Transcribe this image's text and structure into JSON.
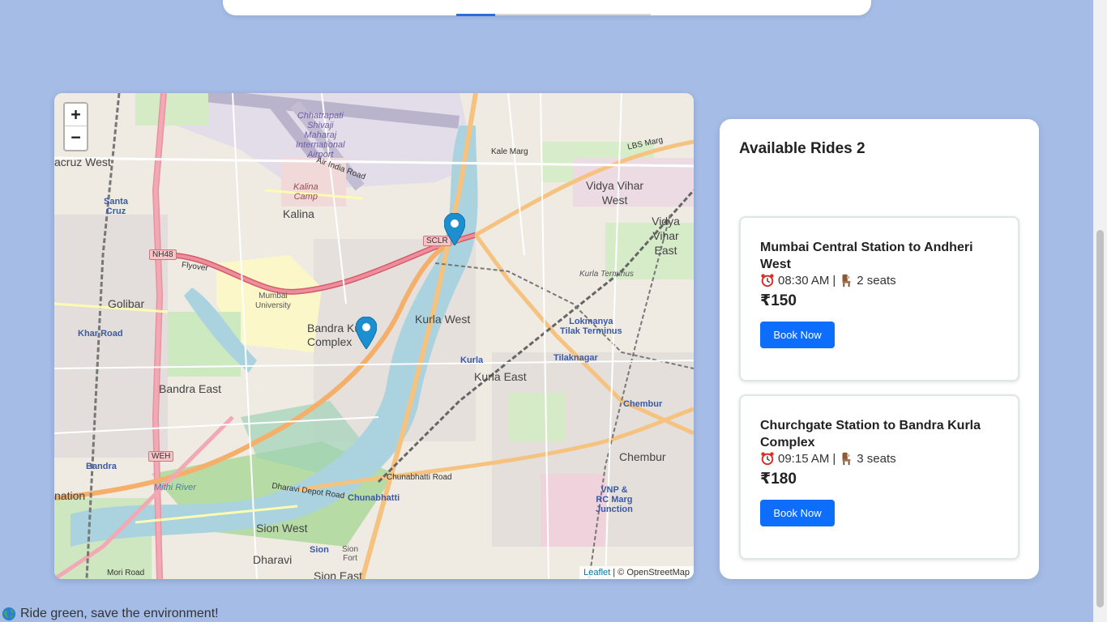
{
  "map": {
    "zoom_in": "+",
    "zoom_out": "−",
    "attribution_leaflet": "Leaflet",
    "attribution_rest": " | © OpenStreetMap",
    "labels": {
      "airport": "Chhatrapati\nShivaji\nMaharaj\nInternational\nAirport",
      "kalina_camp": "Kalina\nCamp",
      "kalina": "Kalina",
      "santacruz_west": "acruz West",
      "santa_cruz": "Santa\nCruz",
      "mumbai_university": "Mumbai\nUniversity",
      "golibar": "Golibar",
      "khar_road": "Khar Road",
      "bandra_east": "Bandra East",
      "bandra": "Bandra",
      "bkc": "Bandra Kurla\nComplex",
      "kurla_west": "Kurla West",
      "kurla": "Kurla",
      "kurla_east": "Kurla East",
      "kurla_terminus": "Kurla Terminus",
      "lokmanya": "Lokmanya\nTilak Terminus",
      "tilaknagar": "Tilaknagar",
      "vidya_vihar_west": "Vidya Vihar\nWest",
      "vidya_vihar_east": "Vidya Vihar\nEast",
      "chembur": "Chembur",
      "chembur_station": "Chembur",
      "chunabhatti": "Chunabhatti",
      "sion_west": "Sion West",
      "sion": "Sion",
      "dharavi": "Dharavi",
      "vnp": "VNP &\nRC Marg\nJunction",
      "mithi_river": "Mithi River",
      "air_india_road": "Air India Road",
      "kale_marg": "Kale Marg",
      "lbs_marg": "LBS Marg",
      "flyover": "Flyover",
      "nation": "nation",
      "mori_road": "Mori Road",
      "dharavi_depot": "Dharavi Depot Road",
      "chunabhatti_road": "Chunabhatti Road",
      "sion_east": "Sion East",
      "sion_fort": "Sion\nFort"
    },
    "shields": {
      "nh48": "NH48",
      "sclr": "SCLR",
      "weh": "WEH"
    }
  },
  "rides": {
    "title": "Available Rides 2",
    "items": [
      {
        "route": "Mumbai Central Station to Andheri West",
        "time": "08:30 AM",
        "separator": "|",
        "seats": "2 seats",
        "price": "₹150",
        "button": "Book Now"
      },
      {
        "route": "Churchgate Station to Bandra Kurla Complex",
        "time": "09:15 AM",
        "separator": "|",
        "seats": "3 seats",
        "price": "₹180",
        "button": "Book Now"
      }
    ]
  },
  "footer": {
    "text": "Ride green, save the environment!"
  },
  "icons": {
    "alarm": "alarm-clock-icon",
    "seat": "seat-icon",
    "globe": "globe-icon",
    "marker": "map-marker-icon"
  },
  "colors": {
    "background": "#a4bce6",
    "button": "#0d6efd",
    "marker": "#1c8fd0"
  }
}
